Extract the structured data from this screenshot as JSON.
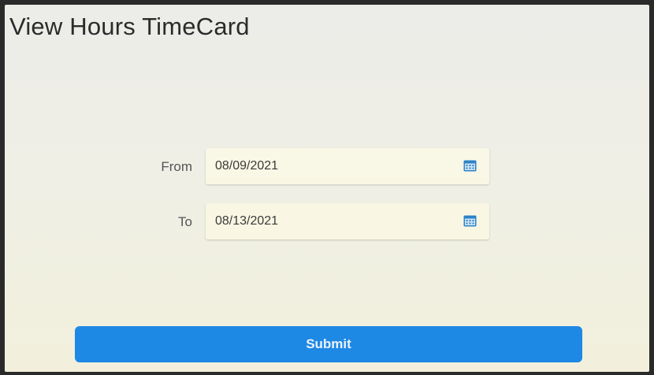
{
  "page": {
    "title": "View Hours TimeCard"
  },
  "form": {
    "from": {
      "label": "From",
      "value": "08/09/2021",
      "icon": "calendar-icon"
    },
    "to": {
      "label": "To",
      "value": "08/13/2021",
      "icon": "calendar-icon"
    },
    "submit_label": "Submit"
  },
  "colors": {
    "accent": "#1e88e5",
    "icon": "#2d83c8"
  }
}
